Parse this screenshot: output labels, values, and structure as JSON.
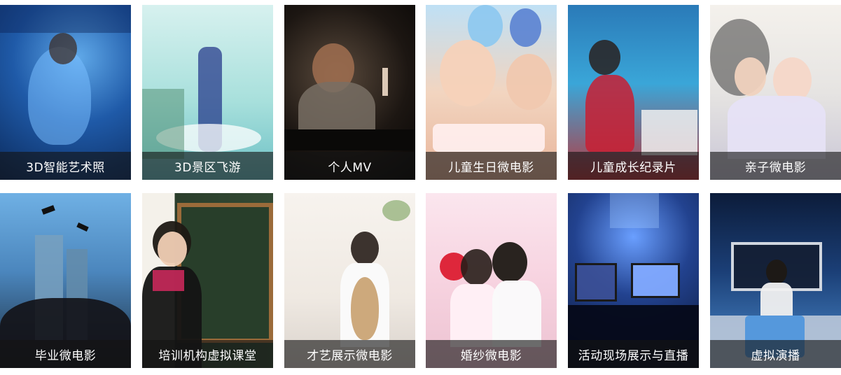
{
  "tiles": [
    {
      "caption": "3D智能艺术照"
    },
    {
      "caption": "3D景区飞游"
    },
    {
      "caption": "个人MV"
    },
    {
      "caption": "儿童生日微电影"
    },
    {
      "caption": "儿童成长纪录片"
    },
    {
      "caption": "亲子微电影"
    },
    {
      "caption": "毕业微电影"
    },
    {
      "caption": "培训机构虚拟课堂"
    },
    {
      "caption": "才艺展示微电影"
    },
    {
      "caption": "婚纱微电影"
    },
    {
      "caption": "活动现场展示与直播"
    },
    {
      "caption": "虚拟演播"
    }
  ]
}
